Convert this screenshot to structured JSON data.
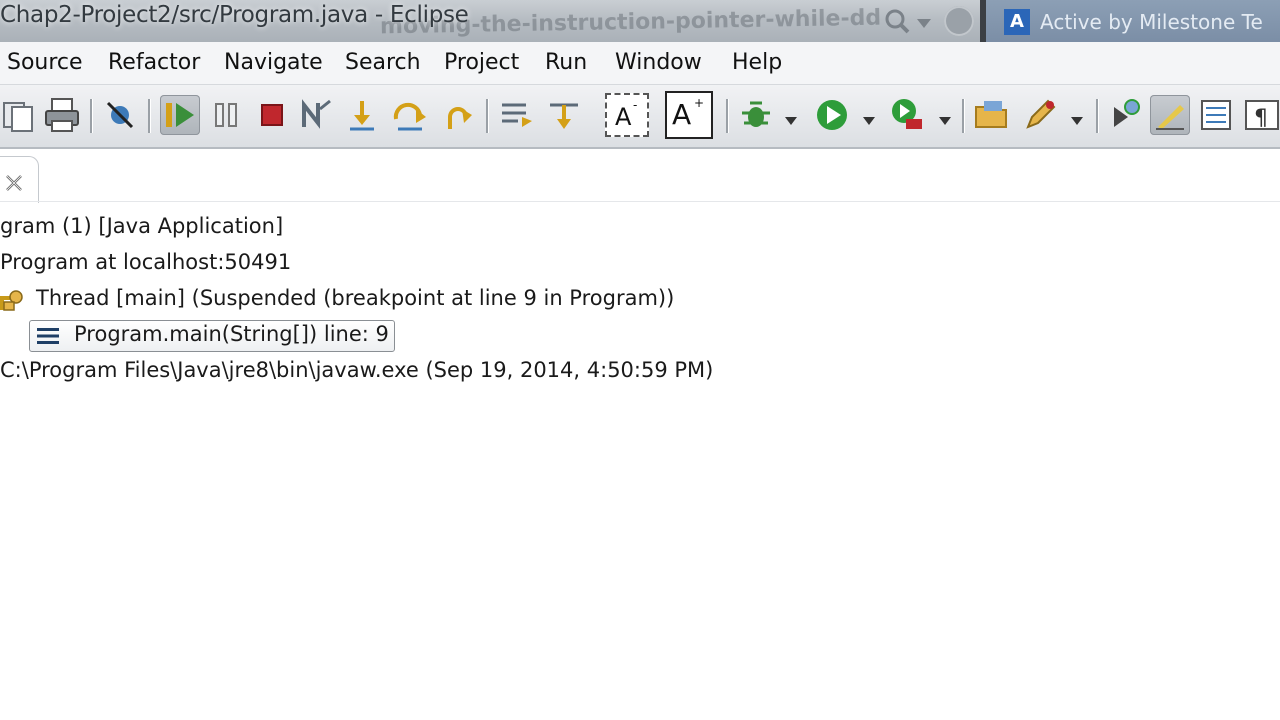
{
  "titlebar": {
    "title": "Chap2-Project2/src/Program.java - Eclipse",
    "ghost_text": "moving-the-instruction-pointer-while-dd",
    "task_label": "Active by Milestone Te",
    "task_logo": "A"
  },
  "menu": {
    "source": "Source",
    "refactor": "Refactor",
    "navigate": "Navigate",
    "search": "Search",
    "project": "Project",
    "run": "Run",
    "window": "Window",
    "help": "Help"
  },
  "debug": {
    "launch": "gram (1) [Java Application]",
    "target": "Program at localhost:50491",
    "thread": "Thread [main] (Suspended (breakpoint at line 9 in Program))",
    "frame": "Program.main(String[]) line: 9",
    "process": "C:\\Program Files\\Java\\jre8\\bin\\javaw.exe (Sep 19, 2014, 4:50:59 PM)"
  },
  "colors": {
    "terminate": "#c0272d",
    "run_green": "#2e9d3a",
    "debug_green": "#3a8f3a"
  }
}
